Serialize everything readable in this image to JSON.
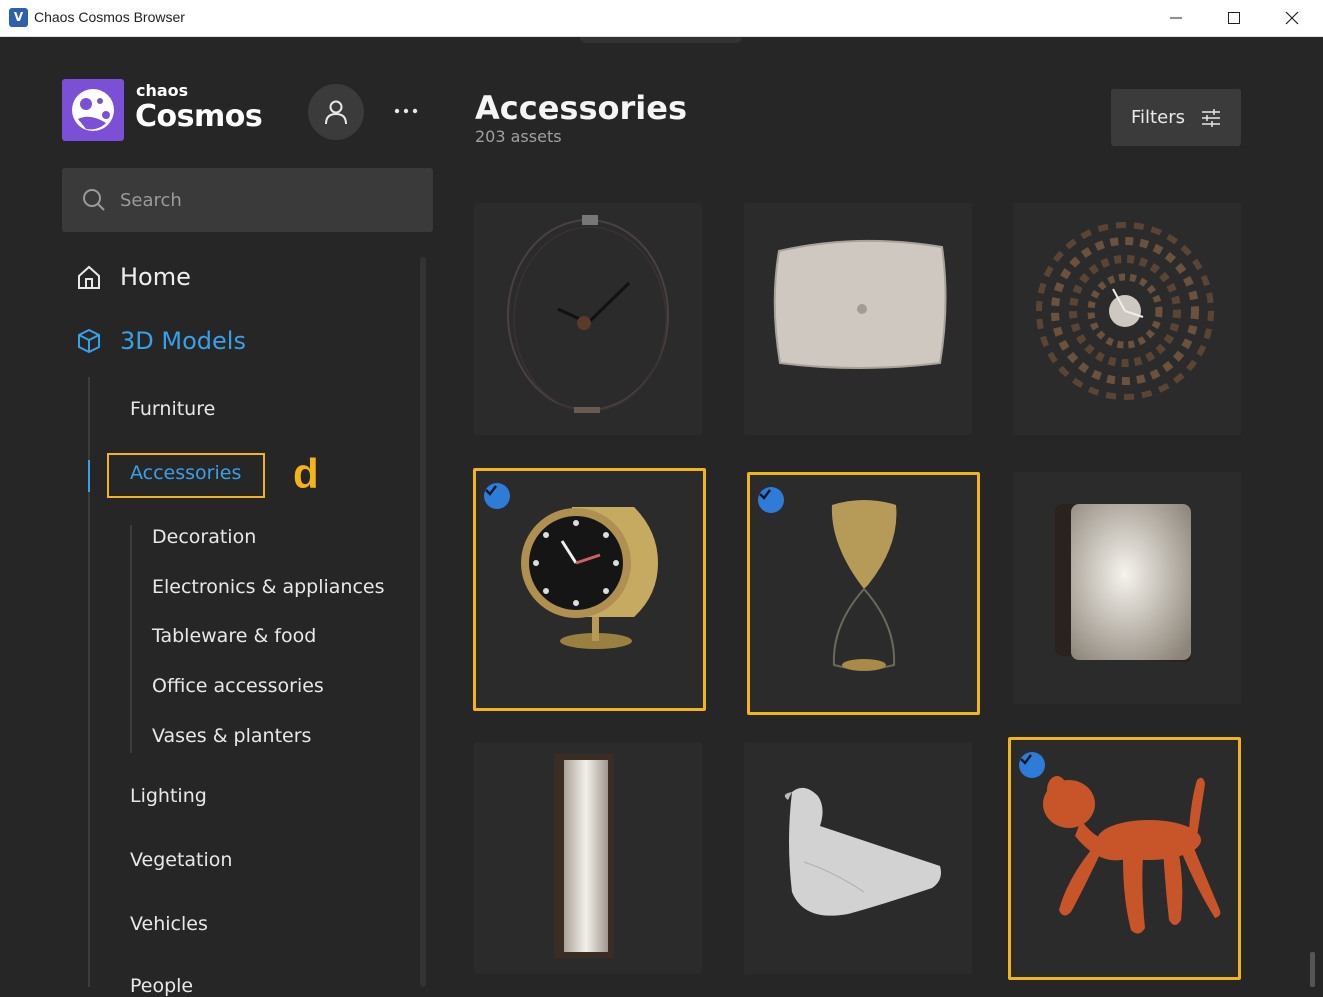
{
  "window": {
    "title": "Chaos Cosmos Browser"
  },
  "brand": {
    "small": "chaos",
    "big": "Cosmos"
  },
  "search": {
    "placeholder": "Search"
  },
  "nav": {
    "home": "Home",
    "models": "3D Models",
    "categories": [
      {
        "label": "Furniture"
      },
      {
        "label": "Accessories",
        "active": true
      },
      {
        "label": "Lighting"
      },
      {
        "label": "Vegetation"
      },
      {
        "label": "Vehicles"
      },
      {
        "label": "People"
      }
    ],
    "subcategories": [
      {
        "label": "Decoration"
      },
      {
        "label": "Electronics & appliances"
      },
      {
        "label": "Tableware & food"
      },
      {
        "label": "Office accessories"
      },
      {
        "label": "Vases & planters"
      }
    ]
  },
  "annotation": {
    "label": "d"
  },
  "header": {
    "title": "Accessories",
    "count": "203 assets",
    "filters": "Filters"
  },
  "assets": [
    {
      "name": "wire-wall-clock",
      "selected": false
    },
    {
      "name": "cushion",
      "selected": false
    },
    {
      "name": "sunburst-wall-clock",
      "selected": false
    },
    {
      "name": "desk-clock",
      "selected": true
    },
    {
      "name": "hourglass",
      "selected": true
    },
    {
      "name": "square-mirror",
      "selected": false
    },
    {
      "name": "tall-mirror",
      "selected": false
    },
    {
      "name": "marble-bird",
      "selected": false
    },
    {
      "name": "orange-dog-toy",
      "selected": true
    }
  ],
  "colors": {
    "accent": "#39a0e8",
    "highlight": "#f2b418",
    "check": "#2f7bd8",
    "logo": "#7b4fd6"
  }
}
